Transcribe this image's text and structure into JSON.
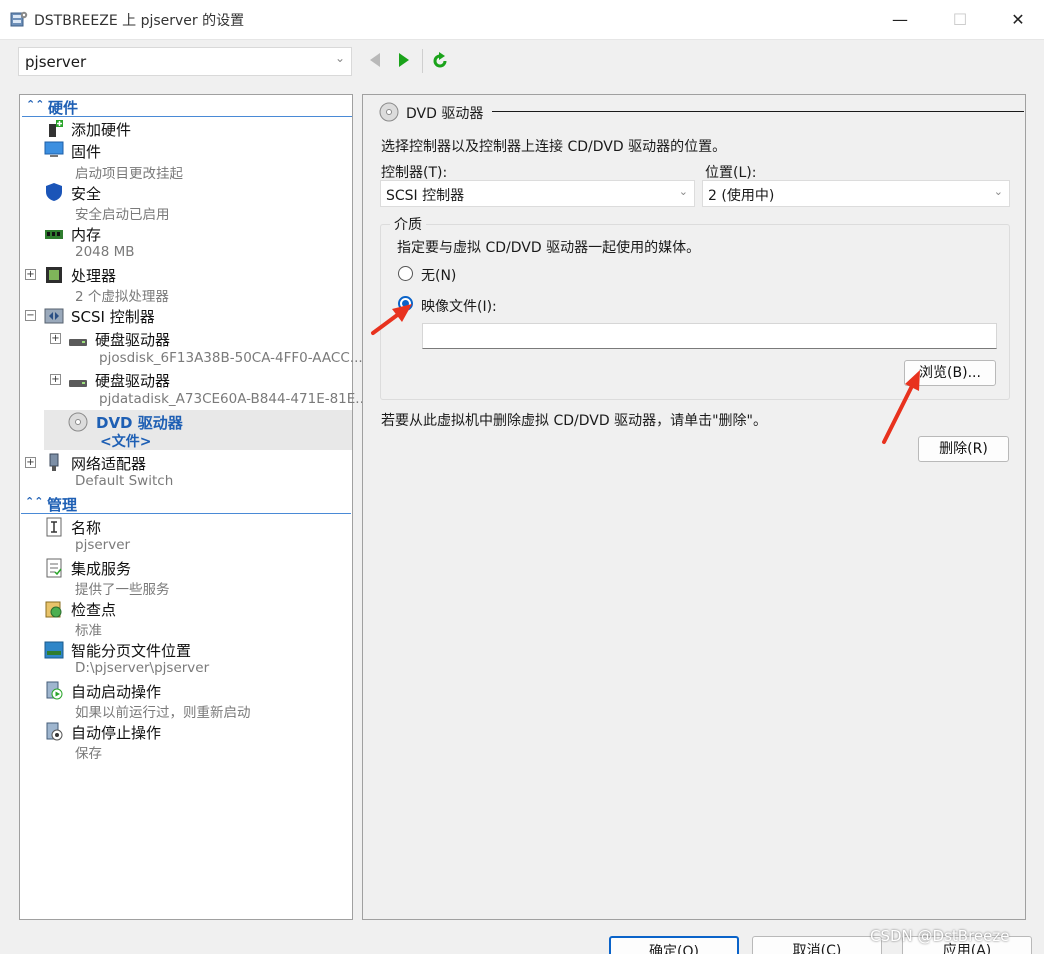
{
  "window": {
    "title": "DSTBREEZE 上 pjserver 的设置",
    "minimize_glyph": "—",
    "maximize_glyph": "☐",
    "close_glyph": "✕"
  },
  "toolbar": {
    "vm_name": "pjserver",
    "icons": [
      "back-arrow-icon",
      "forward-arrow-icon",
      "refresh-icon"
    ],
    "forward_color": "#1aa31a",
    "refresh_color": "#1aa31a"
  },
  "tree": {
    "hardware_section": "硬件",
    "management_section": "管理",
    "items": [
      {
        "title": "添加硬件",
        "subtitle": "",
        "icon": "add-hardware-icon"
      },
      {
        "title": "固件",
        "subtitle": "启动项目更改挂起",
        "icon": "firmware-icon"
      },
      {
        "title": "安全",
        "subtitle": "安全启动已启用",
        "icon": "shield-icon"
      },
      {
        "title": "内存",
        "subtitle": "2048 MB",
        "icon": "memory-icon"
      },
      {
        "title": "处理器",
        "subtitle": "2 个虚拟处理器",
        "icon": "processor-icon"
      },
      {
        "title": "SCSI 控制器",
        "subtitle": "",
        "icon": "scsi-controller-icon"
      },
      {
        "title": "硬盘驱动器",
        "subtitle": "pjosdisk_6F13A38B-50CA-4FF0-AACC...",
        "icon": "hard-drive-icon"
      },
      {
        "title": "硬盘驱动器",
        "subtitle": "pjdatadisk_A73CE60A-B844-471E-81E...",
        "icon": "hard-drive-icon"
      },
      {
        "title": "DVD 驱动器",
        "subtitle": "<文件>",
        "icon": "dvd-drive-icon"
      },
      {
        "title": "网络适配器",
        "subtitle": "Default Switch",
        "icon": "network-adapter-icon"
      },
      {
        "title": "名称",
        "subtitle": "pjserver",
        "icon": "name-icon"
      },
      {
        "title": "集成服务",
        "subtitle": "提供了一些服务",
        "icon": "integration-services-icon"
      },
      {
        "title": "检查点",
        "subtitle": "标准",
        "icon": "checkpoint-icon"
      },
      {
        "title": "智能分页文件位置",
        "subtitle": "D:\\pjserver\\pjserver",
        "icon": "smart-paging-icon"
      },
      {
        "title": "自动启动操作",
        "subtitle": "如果以前运行过，则重新启动",
        "icon": "auto-start-icon"
      },
      {
        "title": "自动停止操作",
        "subtitle": "保存",
        "icon": "auto-stop-icon"
      }
    ],
    "expander_plus": "+",
    "expander_minus": "−"
  },
  "content": {
    "header": "DVD 驱动器",
    "description": "选择控制器以及控制器上连接 CD/DVD 驱动器的位置。",
    "controller_label": "控制器(T):",
    "controller_value": "SCSI 控制器",
    "location_label": "位置(L):",
    "location_value": "2 (使用中)",
    "media_legend": "介质",
    "media_description": "指定要与虚拟 CD/DVD 驱动器一起使用的媒体。",
    "radio_none": "无(N)",
    "radio_image": "映像文件(I):",
    "selected_radio": "映像文件(I):",
    "image_path": "",
    "browse_button": "浏览(B)...",
    "remove_text": "若要从此虚拟机中删除虚拟 CD/DVD 驱动器，请单击\"删除\"。",
    "remove_button": "删除(R)",
    "accent_color": "#0a63c9",
    "annotation_arrow_color": "#e8321e"
  },
  "footer": {
    "ok_button": "确定(O)",
    "cancel_button": "取消(C)",
    "apply_button": "应用(A)"
  },
  "watermark": "CSDN @DstBreeze"
}
